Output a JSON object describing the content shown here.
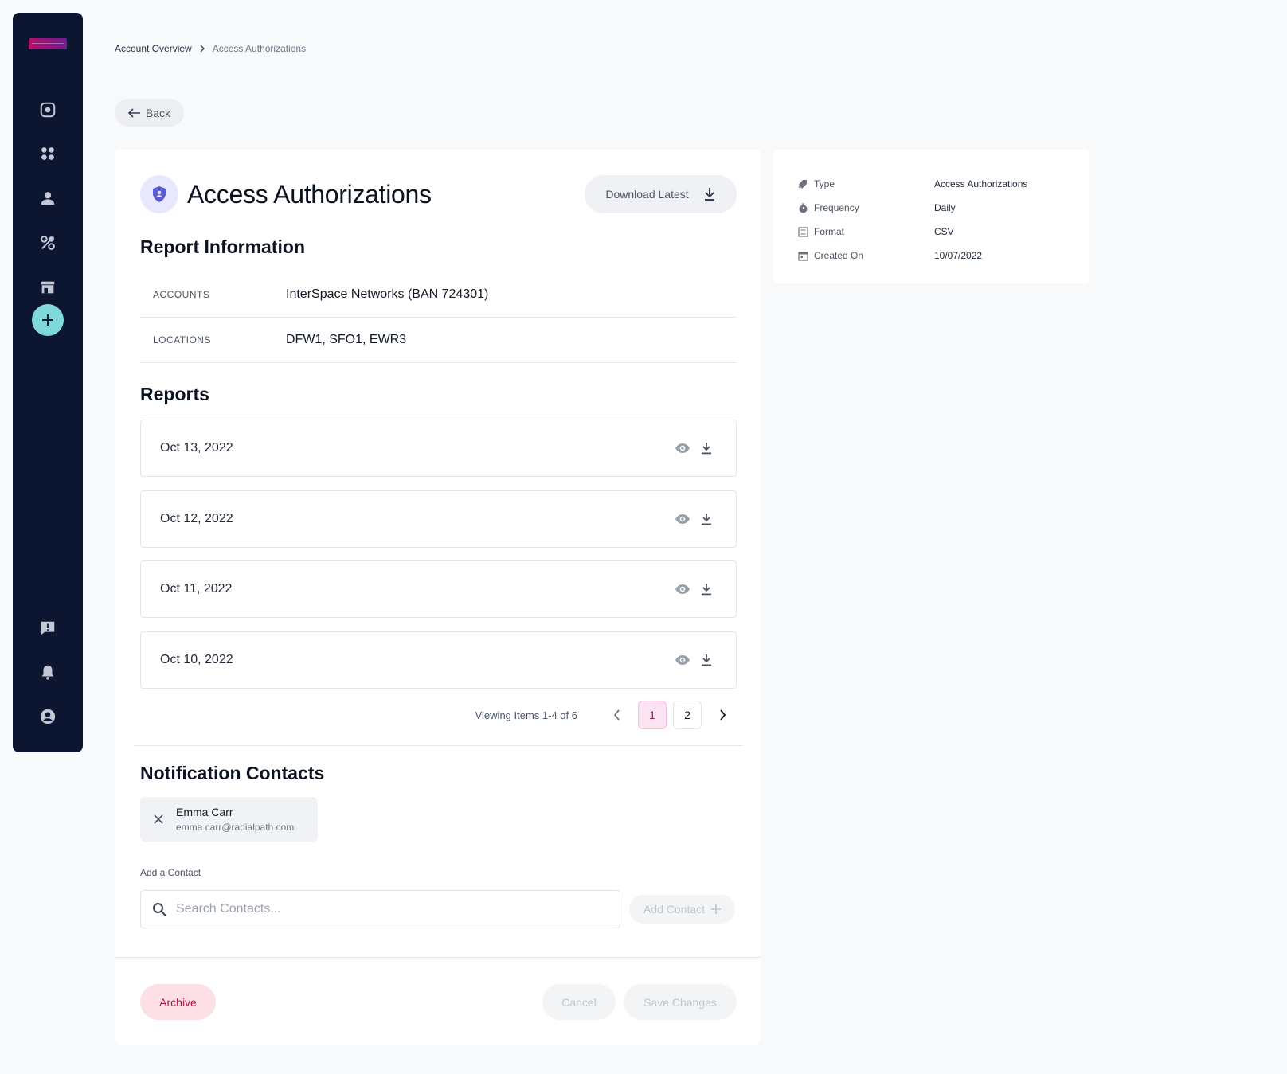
{
  "breadcrumb": {
    "parent": "Account Overview",
    "current": "Access Authorizations"
  },
  "back": {
    "label": "Back"
  },
  "header": {
    "title": "Access Authorizations",
    "download_latest": "Download Latest"
  },
  "report_info": {
    "title": "Report Information",
    "rows": [
      {
        "label": "ACCOUNTS",
        "value": "InterSpace Networks (BAN 724301)"
      },
      {
        "label": "LOCATIONS",
        "value": "DFW1, SFO1, EWR3"
      }
    ]
  },
  "reports": {
    "title": "Reports",
    "items": [
      {
        "date": "Oct 13, 2022"
      },
      {
        "date": "Oct 12, 2022"
      },
      {
        "date": "Oct 11, 2022"
      },
      {
        "date": "Oct 10, 2022"
      }
    ],
    "pagination": {
      "summary": "Viewing Items 1-4 of 6",
      "pages": [
        "1",
        "2"
      ],
      "current": "1"
    }
  },
  "notification_contacts": {
    "title": "Notification Contacts",
    "contacts": [
      {
        "name": "Emma Carr",
        "email": "emma.carr@radialpath.com"
      }
    ],
    "add_label": "Add a Contact",
    "search_placeholder": "Search Contacts...",
    "add_button": "Add Contact"
  },
  "footer": {
    "archive": "Archive",
    "cancel": "Cancel",
    "save": "Save Changes"
  },
  "details": [
    {
      "icon": "tag-icon",
      "label": "Type",
      "value": "Access Authorizations"
    },
    {
      "icon": "stopwatch-icon",
      "label": "Frequency",
      "value": "Daily"
    },
    {
      "icon": "list-icon",
      "label": "Format",
      "value": "CSV"
    },
    {
      "icon": "calendar-icon",
      "label": "Created On",
      "value": "10/07/2022"
    }
  ],
  "colors": {
    "sidebar": "#0c1631",
    "accent_pink": "#9d1769",
    "add_teal": "#7fd9dc",
    "archive_red": "#b4123f"
  }
}
